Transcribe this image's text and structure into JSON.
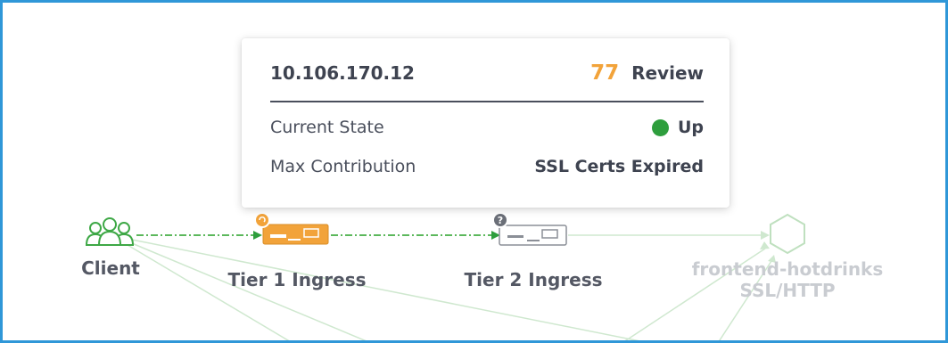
{
  "tooltip": {
    "ip": "10.106.170.12",
    "score": "77",
    "score_label": "Review",
    "rows": [
      {
        "key": "Current State",
        "value": "Up",
        "status_color": "#2e9e3d"
      },
      {
        "key": "Max Contribution",
        "value": "SSL Certs Expired"
      }
    ]
  },
  "nodes": {
    "client": {
      "label": "Client",
      "icon": "users-icon"
    },
    "tier1": {
      "label": "Tier 1 Ingress",
      "icon": "appliance-icon",
      "badge": "alert-badge-icon"
    },
    "tier2": {
      "label": "Tier 2 Ingress",
      "icon": "appliance-icon",
      "badge": "?"
    },
    "frontend": {
      "label_line1": "frontend-hotdrinks",
      "label_line2": "SSL/HTTP",
      "icon": "hexagon-icon"
    }
  },
  "colors": {
    "frame_border": "#2f97d8",
    "link_green": "#5cb85c",
    "tier1_orange": "#f2a33a",
    "score_orange": "#f2a33a"
  }
}
